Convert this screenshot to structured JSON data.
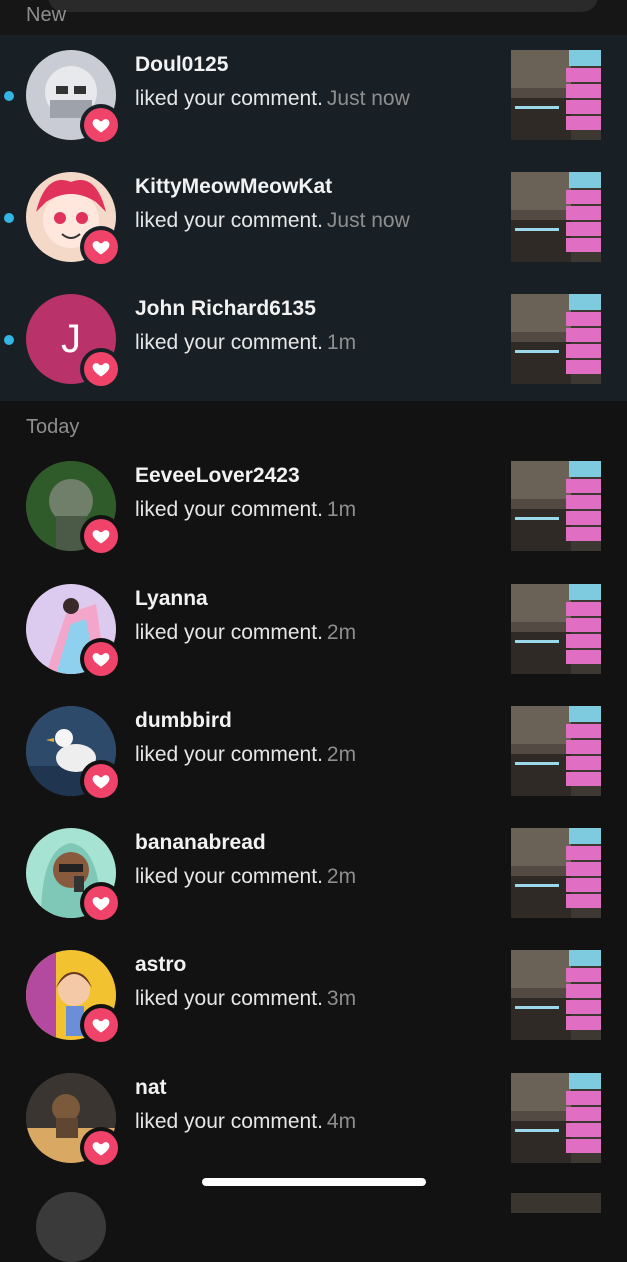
{
  "sections": {
    "new_label": "New",
    "today_label": "Today"
  },
  "colors": {
    "unread_dot": "#33b5e5",
    "heart_badge": "#f0436a",
    "timestamp": "#8e8e8e"
  },
  "icons": {
    "badge": "heart-icon"
  },
  "new_items": [
    {
      "username": "Doul0125",
      "action": "liked your comment.",
      "time": "Just now",
      "unread": true
    },
    {
      "username": "KittyMeowMeowKat",
      "action": "liked your comment.",
      "time": "Just now",
      "unread": true
    },
    {
      "username": "John Richard6135",
      "action": "liked your comment.",
      "time": "1m",
      "unread": true,
      "avatar_letter": "J"
    }
  ],
  "today_items": [
    {
      "username": "EeveeLover2423",
      "action": "liked your comment.",
      "time": "1m"
    },
    {
      "username": "Lyanna",
      "action": "liked your comment.",
      "time": "2m"
    },
    {
      "username": "dumbbird",
      "action": "liked your comment.",
      "time": "2m"
    },
    {
      "username": "bananabread",
      "action": "liked your comment.",
      "time": "2m"
    },
    {
      "username": "astro",
      "action": "liked your comment.",
      "time": "3m"
    },
    {
      "username": "nat",
      "action": "liked your comment.",
      "time": "4m"
    }
  ]
}
